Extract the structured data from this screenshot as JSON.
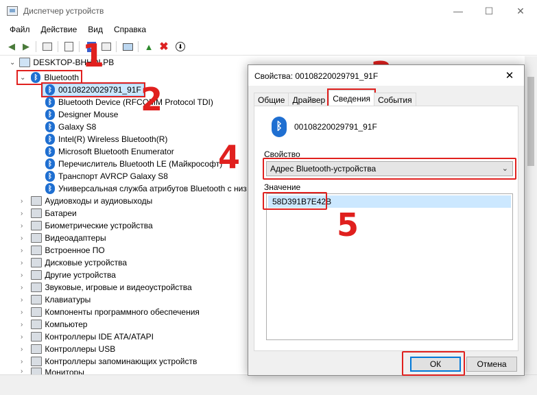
{
  "window": {
    "title": "Диспетчер устройств",
    "minimize": "—",
    "maximize": "☐",
    "close": "✕"
  },
  "menu": [
    "Файл",
    "Действие",
    "Вид",
    "Справка"
  ],
  "toolbar_icons": [
    "back-icon",
    "forward-icon",
    "properties-icon",
    "show-hidden-icon",
    "help-icon",
    "view-icon",
    "monitor-icon",
    "update-driver-icon",
    "uninstall-icon",
    "scan-icon"
  ],
  "tree": {
    "root": "DESKTOP-BHHDLPB",
    "bluetooth_category": "Bluetooth",
    "bluetooth_devices": [
      "00108220029791_91F",
      "Bluetooth Device (RFCOMM Protocol TDI)",
      "Designer Mouse",
      "Galaxy S8",
      "Intel(R) Wireless Bluetooth(R)",
      "Microsoft Bluetooth Enumerator",
      "Перечислитель Bluetooth LE (Майкрософт)",
      "Транспорт AVRCP Galaxy S8",
      "Универсальная служба атрибутов Bluetooth с низ"
    ],
    "categories": [
      "Аудиовходы и аудиовыходы",
      "Батареи",
      "Биометрические устройства",
      "Видеоадаптеры",
      "Встроенное ПО",
      "Дисковые устройства",
      "Другие устройства",
      "Звуковые, игровые и видеоустройства",
      "Клавиатуры",
      "Компоненты программного обеспечения",
      "Компьютер",
      "Контроллеры IDE ATA/ATAPI",
      "Контроллеры USB",
      "Контроллеры запоминающих устройств",
      "Мониторы"
    ]
  },
  "dialog": {
    "title": "Свойства: 00108220029791_91F",
    "close": "✕",
    "tabs": [
      "Общие",
      "Драйвер",
      "Сведения",
      "События"
    ],
    "active_tab": "Сведения",
    "device_name": "00108220029791_91F",
    "property_label": "Свойство",
    "property_value": "Адрес Bluetooth-устройства",
    "value_label": "Значение",
    "value_item": "58D391B7E42B",
    "ok": "ОК",
    "cancel": "Отмена"
  },
  "annotations": [
    "1",
    "2",
    "3",
    "4",
    "5"
  ],
  "colors": {
    "annotation_red": "#e0201e",
    "bluetooth_blue": "#1f6fd1",
    "selection": "#cce8ff"
  }
}
